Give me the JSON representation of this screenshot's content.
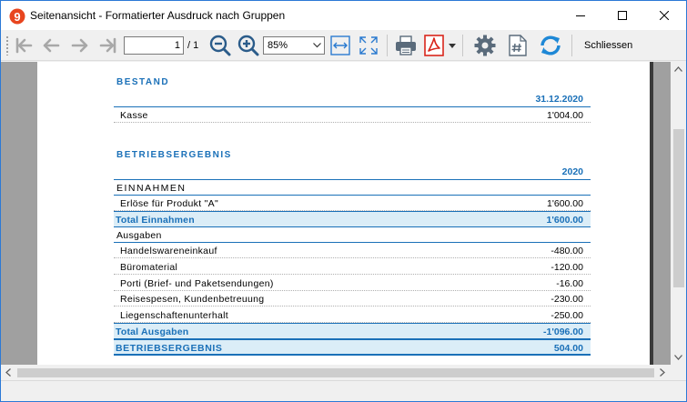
{
  "window": {
    "title": "Seitenansicht - Formatierter Ausdruck nach Gruppen"
  },
  "toolbar": {
    "page_current": "1",
    "page_total": "/ 1",
    "zoom": "85%",
    "close_label": "Schliessen"
  },
  "report": {
    "bestand": {
      "title": "BESTAND",
      "column": "31.12.2020",
      "rows": [
        {
          "label": "Kasse",
          "value": "1'004.00"
        }
      ]
    },
    "betriebsergebnis": {
      "title": "BETRIEBSERGEBNIS",
      "column": "2020",
      "einnahmen_header": "EINNAHMEN",
      "einnahmen_rows": [
        {
          "label": "Erlöse für Produkt \"A\"",
          "value": "1'600.00"
        }
      ],
      "einnahmen_total": {
        "label": "Total Einnahmen",
        "value": "1'600.00"
      },
      "ausgaben_header": "Ausgaben",
      "ausgaben_rows": [
        {
          "label": "Handelswareneinkauf",
          "value": "-480.00"
        },
        {
          "label": "Büromaterial",
          "value": "-120.00"
        },
        {
          "label": "Porti (Brief- und Paketsendungen)",
          "value": "-16.00"
        },
        {
          "label": "Reisespesen, Kundenbetreuung",
          "value": "-230.00"
        },
        {
          "label": "Liegenschaftenunterhalt",
          "value": "-250.00"
        }
      ],
      "ausgaben_total": {
        "label": "Total Ausgaben",
        "value": "-1'096.00"
      },
      "result": {
        "label": "BETRIEBSERGEBNIS",
        "value": "504.00"
      }
    }
  },
  "colors": {
    "accent": "#1a70b8",
    "total_bg": "#dbedf7",
    "pdf_red": "#d9261c",
    "refresh_blue": "#1e88d6"
  }
}
